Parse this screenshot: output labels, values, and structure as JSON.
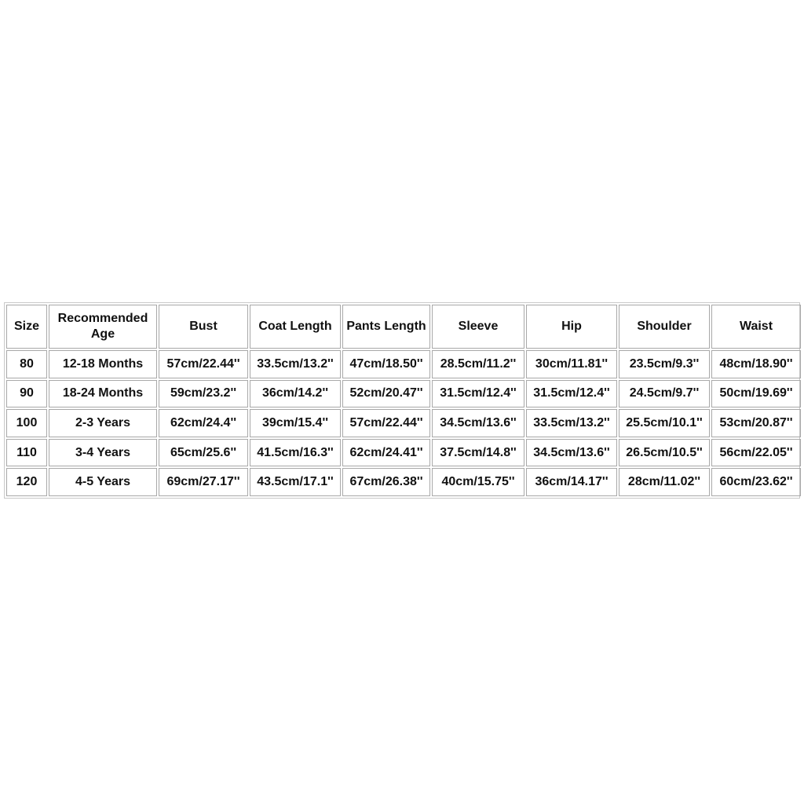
{
  "table": {
    "headers": [
      "Size",
      "Recommended Age",
      "Bust",
      "Coat Length",
      "Pants Length",
      "Sleeve",
      "Hip",
      "Shoulder",
      "Waist"
    ],
    "rows": [
      [
        "80",
        "12-18 Months",
        "57cm/22.44''",
        "33.5cm/13.2''",
        "47cm/18.50''",
        "28.5cm/11.2''",
        "30cm/11.81''",
        "23.5cm/9.3''",
        "48cm/18.90''"
      ],
      [
        "90",
        "18-24 Months",
        "59cm/23.2''",
        "36cm/14.2''",
        "52cm/20.47''",
        "31.5cm/12.4''",
        "31.5cm/12.4''",
        "24.5cm/9.7''",
        "50cm/19.69''"
      ],
      [
        "100",
        "2-3 Years",
        "62cm/24.4''",
        "39cm/15.4''",
        "57cm/22.44''",
        "34.5cm/13.6''",
        "33.5cm/13.2''",
        "25.5cm/10.1''",
        "53cm/20.87''"
      ],
      [
        "110",
        "3-4 Years",
        "65cm/25.6''",
        "41.5cm/16.3''",
        "62cm/24.41''",
        "37.5cm/14.8''",
        "34.5cm/13.6''",
        "26.5cm/10.5''",
        "56cm/22.05''"
      ],
      [
        "120",
        "4-5 Years",
        "69cm/27.17''",
        "43.5cm/17.1''",
        "67cm/26.38''",
        "40cm/15.75''",
        "36cm/14.17''",
        "28cm/11.02''",
        "60cm/23.62''"
      ]
    ]
  }
}
